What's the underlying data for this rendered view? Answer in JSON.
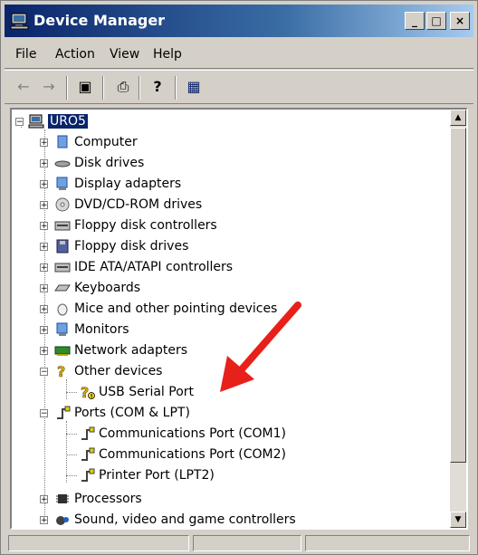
{
  "window": {
    "title": "Device Manager",
    "controls": {
      "minimize": "_",
      "maximize": "□",
      "close": "×"
    }
  },
  "menubar": {
    "items": [
      {
        "label": "File"
      },
      {
        "label": "Action"
      },
      {
        "label": "View"
      },
      {
        "label": "Help"
      }
    ]
  },
  "toolbar": {
    "buttons": [
      {
        "icon": "back-arrow-icon",
        "glyph": "←"
      },
      {
        "icon": "forward-arrow-icon",
        "glyph": "→"
      },
      {
        "icon": "properties-icon",
        "glyph": "▣"
      },
      {
        "icon": "print-icon",
        "glyph": "⎙"
      },
      {
        "icon": "help-icon",
        "glyph": "?"
      },
      {
        "icon": "scan-hardware-icon",
        "glyph": "▦"
      }
    ]
  },
  "tree": {
    "root": "URO5",
    "items": [
      {
        "label": "Computer",
        "icon": "computer-icon"
      },
      {
        "label": "Disk drives",
        "icon": "disk-drive-icon"
      },
      {
        "label": "Display adapters",
        "icon": "display-adapter-icon"
      },
      {
        "label": "DVD/CD-ROM drives",
        "icon": "cdrom-icon"
      },
      {
        "label": "Floppy disk controllers",
        "icon": "floppy-controller-icon"
      },
      {
        "label": "Floppy disk drives",
        "icon": "floppy-drive-icon"
      },
      {
        "label": "IDE ATA/ATAPI controllers",
        "icon": "ide-controller-icon"
      },
      {
        "label": "Keyboards",
        "icon": "keyboard-icon"
      },
      {
        "label": "Mice and other pointing devices",
        "icon": "mouse-icon"
      },
      {
        "label": "Monitors",
        "icon": "monitor-icon"
      },
      {
        "label": "Network adapters",
        "icon": "network-adapter-icon"
      },
      {
        "label": "Other devices",
        "icon": "unknown-device-icon"
      },
      {
        "label": "USB Serial Port",
        "icon": "unknown-device-warning-icon"
      },
      {
        "label": "Ports (COM & LPT)",
        "icon": "port-icon"
      },
      {
        "label": "Communications Port (COM1)",
        "icon": "port-icon"
      },
      {
        "label": "Communications Port (COM2)",
        "icon": "port-icon"
      },
      {
        "label": "Printer Port (LPT2)",
        "icon": "port-icon"
      },
      {
        "label": "Processors",
        "icon": "processor-icon"
      },
      {
        "label": "Sound, video and game controllers",
        "icon": "sound-icon"
      }
    ]
  },
  "annotation": {
    "icon": "red-arrow-icon",
    "color": "#e8201a"
  },
  "colors": {
    "titlebar": "#0a246a",
    "selection": "#0a246a",
    "face": "#d4d0c8"
  }
}
